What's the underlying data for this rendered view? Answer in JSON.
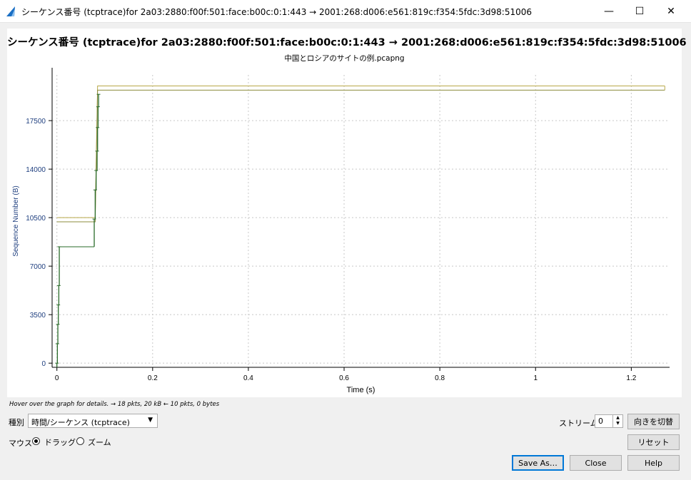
{
  "window": {
    "title": "シーケンス番号 (tcptrace)for 2a03:2880:f00f:501:face:b00c:0:1:443 → 2001:268:d006:e561:819c:f354:5fdc:3d98:51006",
    "minimize_glyph": "—",
    "maximize_glyph": "☐",
    "close_glyph": "✕",
    "icon": "wireshark-fin-icon"
  },
  "plot": {
    "title": "シーケンス番号 (tcptrace)for 2a03:2880:f00f:501:face:b00c:0:1:443 → 2001:268:d006:e561:819c:f354:5fdc:3d98:51006",
    "subtitle": "中国とロシアのサイトの例.pcapng"
  },
  "chart_data": {
    "type": "line",
    "xlabel": "Time (s)",
    "ylabel": "Sequence Number (B)",
    "xlim": [
      -0.01,
      1.28
    ],
    "ylim": [
      -300,
      20800
    ],
    "x_ticks": [
      "0",
      "0.2",
      "0.4",
      "0.6",
      "0.8",
      "1",
      "1.2"
    ],
    "y_ticks": [
      "0",
      "3500",
      "7000",
      "10500",
      "14000",
      "17500"
    ],
    "grid": true,
    "colors": {
      "data": "#2a6b2a",
      "window": "#b8a848",
      "ack": "#8c8c3c",
      "axis_text": "#1f3f7f"
    },
    "series": [
      {
        "x": [
          0,
          0.001,
          0.002,
          0.003,
          0.004,
          0.005,
          0.078,
          0.08,
          0.082,
          0.084,
          0.085,
          0.086,
          0.087
        ],
        "y": [
          0,
          1400,
          2800,
          4200,
          5600,
          8400,
          10400,
          12500,
          13900,
          15300,
          17000,
          18500,
          19400
        ]
      }
    ],
    "window_line": {
      "x": [
        0,
        0.08,
        0.085,
        1.27,
        1.27
      ],
      "upper": [
        10500,
        10500,
        20000,
        20000,
        20000
      ],
      "lower": [
        10200,
        10200,
        19700,
        19700,
        19700
      ]
    }
  },
  "hover_text": "Hover over the graph for details. → 18 pkts, 20 kB ← 10 pkts, 0 bytes",
  "controls": {
    "type_label": "種別",
    "type_value": "時間/シーケンス (tcptrace)",
    "mouse_label": "マウス",
    "drag_label": "ドラッグ",
    "zoom_label": "ズーム",
    "stream_label": "ストリーム",
    "stream_value": "0",
    "switch_direction": "向きを切替",
    "reset": "リセット",
    "save_as": "Save As…",
    "close": "Close",
    "help": "Help"
  }
}
